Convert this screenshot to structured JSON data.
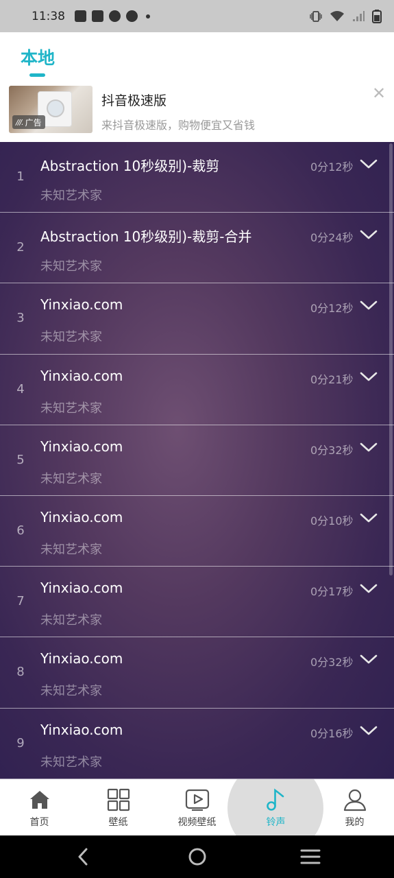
{
  "status_bar": {
    "time": "11:38",
    "left_icons": [
      "notification-bag-icon",
      "notification-bag-icon",
      "compass-icon",
      "compass-icon",
      "dot-icon"
    ],
    "right_icons": [
      "vibrate-icon",
      "wifi-icon",
      "signal-icon",
      "battery-icon"
    ]
  },
  "header": {
    "tab_label": "本地"
  },
  "ad": {
    "title": "抖音极速版",
    "subtitle": "来抖音极速版，购物便宜又省钱",
    "badge_label": "广告",
    "badge_logo": "///."
  },
  "list": {
    "items": [
      {
        "number": "1",
        "title": "Abstraction 10秒级别)-裁剪",
        "artist": "未知艺术家",
        "duration": "0分12秒"
      },
      {
        "number": "2",
        "title": "Abstraction 10秒级别)-裁剪-合并",
        "artist": "未知艺术家",
        "duration": "0分24秒"
      },
      {
        "number": "3",
        "title": "Yinxiao.com",
        "artist": "未知艺术家",
        "duration": "0分12秒"
      },
      {
        "number": "4",
        "title": "Yinxiao.com",
        "artist": "未知艺术家",
        "duration": "0分21秒"
      },
      {
        "number": "5",
        "title": "Yinxiao.com",
        "artist": "未知艺术家",
        "duration": "0分32秒"
      },
      {
        "number": "6",
        "title": "Yinxiao.com",
        "artist": "未知艺术家",
        "duration": "0分10秒"
      },
      {
        "number": "7",
        "title": "Yinxiao.com",
        "artist": "未知艺术家",
        "duration": "0分17秒"
      },
      {
        "number": "8",
        "title": "Yinxiao.com",
        "artist": "未知艺术家",
        "duration": "0分32秒"
      },
      {
        "number": "9",
        "title": "Yinxiao.com",
        "artist": "未知艺术家",
        "duration": "0分16秒"
      }
    ]
  },
  "bottom_nav": {
    "items": [
      {
        "label": "首页",
        "icon": "home-icon"
      },
      {
        "label": "壁纸",
        "icon": "grid-icon"
      },
      {
        "label": "视频壁纸",
        "icon": "video-play-icon"
      },
      {
        "label": "铃声",
        "icon": "music-note-icon",
        "active": true
      },
      {
        "label": "我的",
        "icon": "user-icon"
      }
    ]
  },
  "colors": {
    "accent": "#1fb5c8",
    "list_bg": "#3a2754",
    "status_bar_bg": "#c9c9c9"
  }
}
